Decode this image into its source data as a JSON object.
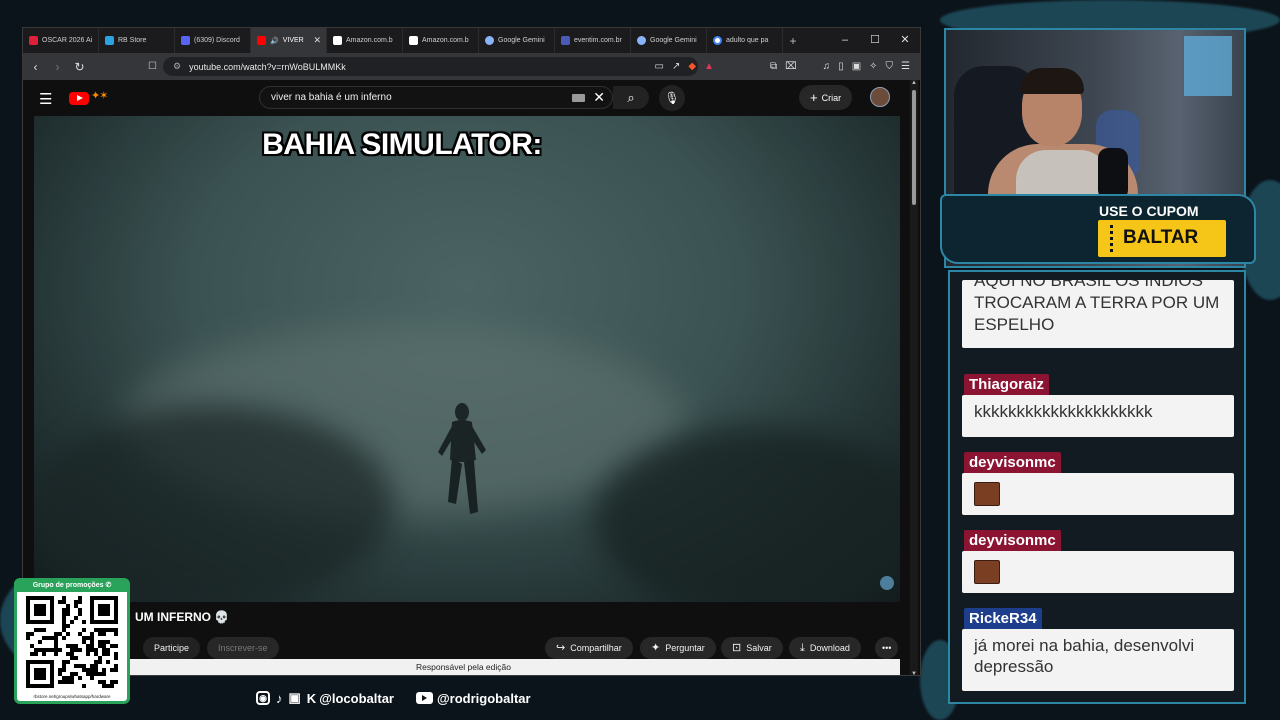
{
  "browser": {
    "tabs": [
      {
        "label": "OSCAR 2026 Ai",
        "color": "#e0203a",
        "active": false
      },
      {
        "label": "RB Store",
        "color": "#2aa3e0",
        "active": false
      },
      {
        "label": "(6309) Discord",
        "color": "#5865f2",
        "active": false
      },
      {
        "label": "VIVER",
        "color": "#ff0000",
        "active": true
      },
      {
        "label": "Amazon.com.b",
        "color": "#ffffff",
        "active": false
      },
      {
        "label": "Amazon.com.b",
        "color": "#ffffff",
        "active": false
      },
      {
        "label": "Google Gemini",
        "color": "#8ab4f8",
        "active": false
      },
      {
        "label": "eventim.com.br",
        "color": "#1a2a6c",
        "active": false
      },
      {
        "label": "Google Gemini",
        "color": "#8ab4f8",
        "active": false
      },
      {
        "label": "adulto que pa",
        "color": "#4285f4",
        "active": false
      }
    ],
    "url": "youtube.com/watch?v=rnWoBULMMKk"
  },
  "youtube": {
    "search_query": "viver na bahia é um inferno",
    "create_label": "Criar",
    "video_caption": "BAHIA SIMULATOR:",
    "video_title": "UM INFERNO 💀",
    "participe_label": "Participe",
    "subscribe_label": "Inscrever-se",
    "actions": [
      {
        "label": "Compartilhar",
        "icon": "share-icon"
      },
      {
        "label": "Perguntar",
        "icon": "sparkle-icon"
      },
      {
        "label": "Salvar",
        "icon": "bookmark-icon"
      },
      {
        "label": "Download",
        "icon": "download-icon"
      }
    ],
    "edit_notice": "Responsável pela edição"
  },
  "overlay": {
    "cupom_label": "USE O CUPOM",
    "cupom_code": "BALTAR",
    "qr_label": "Grupo de promoções",
    "qr_footer": "rbstore.net/groups/whatsapp/hardware",
    "social_handle_1": "@locobaltar",
    "social_handle_2": "@rodrigobaltar"
  },
  "chat": {
    "messages": [
      {
        "name": "",
        "text": "AQUI NO BRASIL OS INDIOS TROCARAM A TERRA POR UM ESPELHO"
      },
      {
        "name": "Thiagoraiz",
        "text": "kkkkkkkkkkkkkkkkkkkkk"
      },
      {
        "name": "deyvisonmc",
        "text": "",
        "emote": "face-emote"
      },
      {
        "name": "deyvisonmc",
        "text": "",
        "emote": "face-emote"
      },
      {
        "name": "RickeR34",
        "text": "já morei na bahia, desenvolvi depressão"
      }
    ]
  }
}
